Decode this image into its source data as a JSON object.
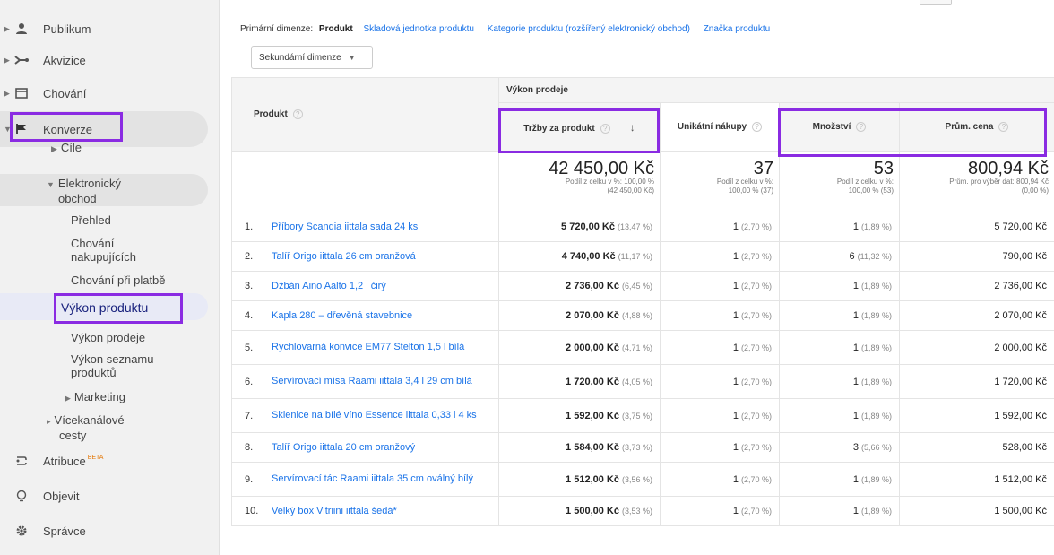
{
  "sidebar": {
    "top_items": [
      {
        "label": "Publikum",
        "icon": "person-icon"
      },
      {
        "label": "Akvizice",
        "icon": "acquisition-icon"
      },
      {
        "label": "Chování",
        "icon": "behavior-icon"
      },
      {
        "label": "Konverze",
        "icon": "flag-icon"
      }
    ],
    "sub": {
      "cile": "Cíle",
      "ecom_line1": "Elektronický",
      "ecom_line2": "obchod",
      "prehled": "Přehled",
      "chovani_nak_1": "Chování",
      "chovani_nak_2": "nakupujících",
      "chovani_platba": "Chování při platbě",
      "vykon_produktu": "Výkon produktu",
      "vykon_prodeje": "Výkon prodeje",
      "vykon_seznamu_1": "Výkon seznamu",
      "vykon_seznamu_2": "produktů",
      "marketing": "Marketing",
      "vicekanal_1": "Vícekanálové",
      "vicekanal_2": "cesty"
    },
    "bottom_items": [
      {
        "label": "Atribuce",
        "badge": "BETA",
        "icon": "attribution-icon"
      },
      {
        "label": "Objevit",
        "icon": "lightbulb-icon"
      },
      {
        "label": "Správce",
        "icon": "gear-icon"
      }
    ]
  },
  "dimensions": {
    "label": "Primární dimenze:",
    "current": "Produkt",
    "links": [
      "Skladová jednotka produktu",
      "Kategorie produktu (rozšířený elektronický obchod)",
      "Značka produktu"
    ],
    "secondary": "Sekundární dimenze"
  },
  "table": {
    "col_product": "Produkt",
    "group_header": "Výkon prodeje",
    "metrics": [
      "Tržby za produkt",
      "Unikátní nákupy",
      "Množství",
      "Prům. cena"
    ],
    "totals": [
      {
        "value": "42 450,00 Kč",
        "sub1": "Podíl z celku v %: 100,00 %",
        "sub2": "(42 450,00 Kč)"
      },
      {
        "value": "37",
        "sub1": "Podíl z celku v %:",
        "sub2": "100,00 % (37)"
      },
      {
        "value": "53",
        "sub1": "Podíl z celku v %:",
        "sub2": "100,00 % (53)"
      },
      {
        "value": "800,94 Kč",
        "sub1": "Prům. pro výběr dat: 800,94 Kč",
        "sub2": "(0,00 %)"
      }
    ],
    "rows": [
      {
        "n": "1.",
        "name": "Příbory Scandia iittala sada 24 ks",
        "rev": "5 720,00 Kč",
        "rev_pct": "(13,47 %)",
        "uniq": "1",
        "uniq_pct": "(2,70 %)",
        "qty": "1",
        "qty_pct": "(1,89 %)",
        "avg": "5 720,00 Kč"
      },
      {
        "n": "2.",
        "name": "Talíř Origo iittala 26 cm oranžová",
        "rev": "4 740,00 Kč",
        "rev_pct": "(11,17 %)",
        "uniq": "1",
        "uniq_pct": "(2,70 %)",
        "qty": "6",
        "qty_pct": "(11,32 %)",
        "avg": "790,00 Kč"
      },
      {
        "n": "3.",
        "name": "Džbán Aino Aalto 1,2 l čirý",
        "rev": "2 736,00 Kč",
        "rev_pct": "(6,45 %)",
        "uniq": "1",
        "uniq_pct": "(2,70 %)",
        "qty": "1",
        "qty_pct": "(1,89 %)",
        "avg": "2 736,00 Kč"
      },
      {
        "n": "4.",
        "name": "Kapla 280 – dřevěná stavebnice",
        "rev": "2 070,00 Kč",
        "rev_pct": "(4,88 %)",
        "uniq": "1",
        "uniq_pct": "(2,70 %)",
        "qty": "1",
        "qty_pct": "(1,89 %)",
        "avg": "2 070,00 Kč"
      },
      {
        "n": "5.",
        "name": "Rychlovarná konvice EM77 Stelton 1,5 l bílá",
        "rev": "2 000,00 Kč",
        "rev_pct": "(4,71 %)",
        "uniq": "1",
        "uniq_pct": "(2,70 %)",
        "qty": "1",
        "qty_pct": "(1,89 %)",
        "avg": "2 000,00 Kč"
      },
      {
        "n": "6.",
        "name": "Servírovací mísa Raami iittala 3,4 l 29 cm bílá",
        "rev": "1 720,00 Kč",
        "rev_pct": "(4,05 %)",
        "uniq": "1",
        "uniq_pct": "(2,70 %)",
        "qty": "1",
        "qty_pct": "(1,89 %)",
        "avg": "1 720,00 Kč"
      },
      {
        "n": "7.",
        "name": "Sklenice na bílé víno Essence iittala 0,33 l 4 ks",
        "rev": "1 592,00 Kč",
        "rev_pct": "(3,75 %)",
        "uniq": "1",
        "uniq_pct": "(2,70 %)",
        "qty": "1",
        "qty_pct": "(1,89 %)",
        "avg": "1 592,00 Kč"
      },
      {
        "n": "8.",
        "name": "Talíř Origo iittala 20 cm oranžový",
        "rev": "1 584,00 Kč",
        "rev_pct": "(3,73 %)",
        "uniq": "1",
        "uniq_pct": "(2,70 %)",
        "qty": "3",
        "qty_pct": "(5,66 %)",
        "avg": "528,00 Kč"
      },
      {
        "n": "9.",
        "name": "Servírovací tác Raami iittala 35 cm oválný bílý",
        "rev": "1 512,00 Kč",
        "rev_pct": "(3,56 %)",
        "uniq": "1",
        "uniq_pct": "(2,70 %)",
        "qty": "1",
        "qty_pct": "(1,89 %)",
        "avg": "1 512,00 Kč"
      },
      {
        "n": "10.",
        "name": "Velký box Vitriini iittala šedá*",
        "rev": "1 500,00 Kč",
        "rev_pct": "(3,53 %)",
        "uniq": "1",
        "uniq_pct": "(2,70 %)",
        "qty": "1",
        "qty_pct": "(1,89 %)",
        "avg": "1 500,00 Kč"
      }
    ]
  },
  "colors": {
    "highlight": "#8a2be2",
    "link": "#1a73e8"
  }
}
